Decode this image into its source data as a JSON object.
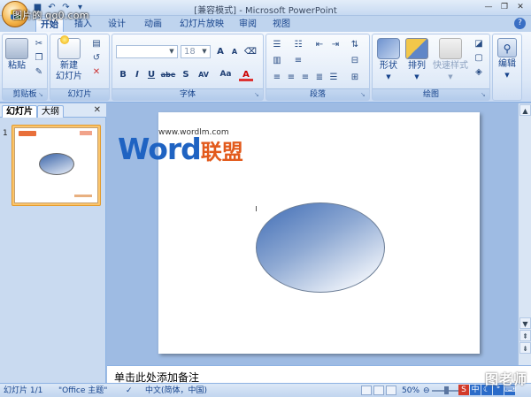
{
  "window": {
    "title": "[兼容模式] - Microsoft PowerPoint",
    "overlay_url": "图片的 qq0.com"
  },
  "quick_access": [
    "save-icon",
    "undo-icon",
    "redo-icon",
    "customize-icon"
  ],
  "window_controls": [
    "minimize",
    "maximize",
    "close"
  ],
  "tabs": [
    "开始",
    "插入",
    "设计",
    "动画",
    "幻灯片放映",
    "审阅",
    "视图"
  ],
  "active_tab": "开始",
  "ribbon": {
    "clipboard": {
      "paste": "粘贴",
      "label": "剪贴板"
    },
    "slides": {
      "new_slide_line1": "新建",
      "new_slide_line2": "幻灯片",
      "label": "幻灯片"
    },
    "font": {
      "font_name": "",
      "font_size": "18",
      "buttons": [
        "B",
        "I",
        "U",
        "abe",
        "S",
        "AV",
        "Aa"
      ],
      "label": "字体"
    },
    "paragraph": {
      "label": "段落"
    },
    "drawing": {
      "shapes": "形状",
      "arrange": "排列",
      "quick_styles": "快速样式",
      "label": "绘图"
    },
    "editing": {
      "edit": "编辑"
    }
  },
  "left_panel": {
    "tabs": [
      "幻灯片",
      "大纲"
    ],
    "active_tab": "幻灯片",
    "slide_number": "1"
  },
  "slide": {
    "logo_url": "www.wordlm.com",
    "logo_word": "Word",
    "logo_cn": "联盟"
  },
  "notes": {
    "placeholder": "单击此处添加备注"
  },
  "status": {
    "slide_counter": "幻灯片 1/1",
    "theme": "\"Office 主题\"",
    "language": "中文(简体，中国)",
    "zoom": "50%"
  },
  "brand_watermark": "图老师"
}
